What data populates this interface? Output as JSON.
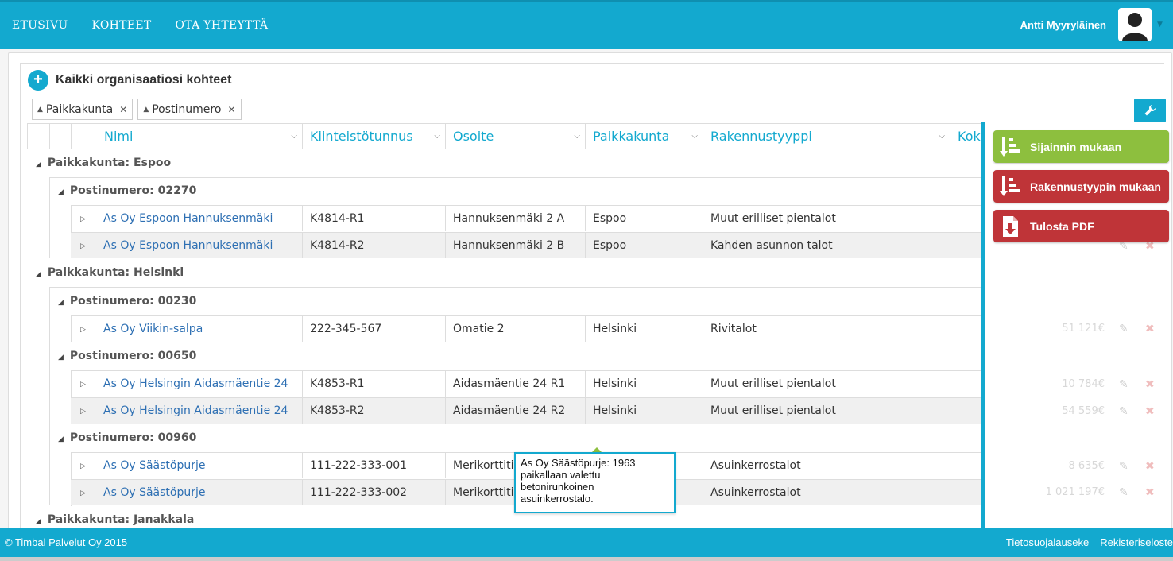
{
  "nav": {
    "items": [
      "ETUSIVU",
      "KOHTEET",
      "OTA YHTEYTTÄ"
    ]
  },
  "user": {
    "name": "Antti Myyryläinen"
  },
  "page": {
    "title": "Kaikki organisaatiosi kohteet"
  },
  "grouping": {
    "chips": [
      "Paikkakunta",
      "Postinumero"
    ]
  },
  "table": {
    "columns": [
      "Nimi",
      "Kiinteistötunnus",
      "Osoite",
      "Paikkakunta",
      "Rakennustyyppi",
      "Kok"
    ],
    "groups": [
      {
        "label": "Paikkakunta: Espoo",
        "subgroups": [
          {
            "label": "Postinumero: 02270",
            "rows": [
              {
                "name": "As Oy Espoon Hannuksenmäki",
                "id": "K4814-R1",
                "address": "Hannuksenmäki 2 A",
                "city": "Espoo",
                "type": "Muut erilliset pientalot",
                "value": ""
              },
              {
                "name": "As Oy Espoon Hannuksenmäki",
                "id": "K4814-R2",
                "address": "Hannuksenmäki 2 B",
                "city": "Espoo",
                "type": "Kahden asunnon talot",
                "value": ""
              }
            ]
          }
        ]
      },
      {
        "label": "Paikkakunta: Helsinki",
        "subgroups": [
          {
            "label": "Postinumero: 00230",
            "rows": [
              {
                "name": "As Oy Viikin-salpa",
                "id": "222-345-567",
                "address": "Omatie 2",
                "city": "Helsinki",
                "type": "Rivitalot",
                "value": "51 121€"
              }
            ]
          },
          {
            "label": "Postinumero: 00650",
            "rows": [
              {
                "name": "As Oy Helsingin Aidasmäentie 24",
                "id": "K4853-R1",
                "address": "Aidasmäentie 24 R1",
                "city": "Helsinki",
                "type": "Muut erilliset pientalot",
                "value": "10 784€"
              },
              {
                "name": "As Oy Helsingin Aidasmäentie 24",
                "id": "K4853-R2",
                "address": "Aidasmäentie 24 R2",
                "city": "Helsinki",
                "type": "Muut erilliset pientalot",
                "value": "54 559€"
              }
            ]
          },
          {
            "label": "Postinumero: 00960",
            "rows": [
              {
                "name": "As Oy Säästöpurje",
                "id": "111-222-333-001",
                "address": "Merikorttitie",
                "city": "",
                "type": "Asuinkerrostalot",
                "value": "8 635€"
              },
              {
                "name": "As Oy Säästöpurje",
                "id": "111-222-333-002",
                "address": "Merikorttitie",
                "city": "",
                "type": "Asuinkerrostalot",
                "value": "1 021 197€"
              }
            ]
          }
        ]
      },
      {
        "label": "Paikkakunta: Janakkala",
        "subgroups": []
      }
    ]
  },
  "actions": {
    "by_location": "Sijainnin mukaan",
    "by_type": "Rakennustyypin mukaan",
    "pdf": "Tulosta PDF"
  },
  "tooltip": {
    "text": "As Oy Säästöpurje: 1963 paikallaan valettu betonirunkoinen asuinkerrostalo."
  },
  "footer": {
    "copyright": "© Timbal Palvelut Oy 2015",
    "links": [
      "Tietosuojalauseke",
      "Rekisteriseloste"
    ]
  },
  "colors": {
    "primary": "#13a9cf",
    "green": "#8dbf3e",
    "red": "#bf3438",
    "link": "#2d6fb3"
  }
}
